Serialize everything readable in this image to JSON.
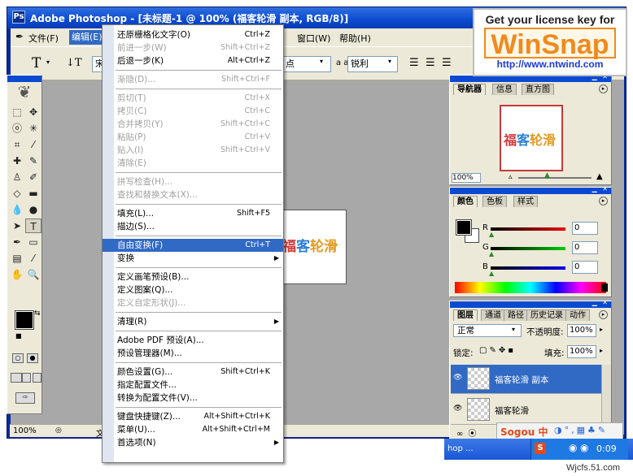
{
  "window": {
    "title": "Adobe Photoshop - [未标题-1 @ 100% (福客轮滑 副本, RGB/8)]"
  },
  "menubar": {
    "items": [
      "文件(F)",
      "编辑(E)",
      "窗口(W)",
      "帮助(H)"
    ]
  },
  "options": {
    "font_partial": "宋",
    "size_partial": "点",
    "aa_label": "a a",
    "antialias": "锐利"
  },
  "edit_menu": {
    "items": [
      {
        "label": "还原栅格化文字(O)",
        "shortcut": "Ctrl+Z",
        "state": "normal"
      },
      {
        "label": "前进一步(W)",
        "shortcut": "Shift+Ctrl+Z",
        "state": "disabled"
      },
      {
        "label": "后退一步(K)",
        "shortcut": "Alt+Ctrl+Z",
        "state": "normal"
      },
      {
        "sep": true
      },
      {
        "label": "渐隐(D)...",
        "shortcut": "Shift+Ctrl+F",
        "state": "disabled"
      },
      {
        "sep": true
      },
      {
        "label": "剪切(T)",
        "shortcut": "Ctrl+X",
        "state": "disabled"
      },
      {
        "label": "拷贝(C)",
        "shortcut": "Ctrl+C",
        "state": "disabled"
      },
      {
        "label": "合并拷贝(Y)",
        "shortcut": "Shift+Ctrl+C",
        "state": "disabled"
      },
      {
        "label": "粘贴(P)",
        "shortcut": "Ctrl+V",
        "state": "disabled"
      },
      {
        "label": "贴入(I)",
        "shortcut": "Shift+Ctrl+V",
        "state": "disabled"
      },
      {
        "label": "清除(E)",
        "shortcut": "",
        "state": "disabled"
      },
      {
        "sep": true
      },
      {
        "label": "拼写检查(H)...",
        "shortcut": "",
        "state": "disabled"
      },
      {
        "label": "查找和替换文本(X)...",
        "shortcut": "",
        "state": "disabled"
      },
      {
        "sep": true
      },
      {
        "label": "填充(L)...",
        "shortcut": "Shift+F5",
        "state": "normal"
      },
      {
        "label": "描边(S)...",
        "shortcut": "",
        "state": "normal"
      },
      {
        "sep": true
      },
      {
        "label": "自由变换(F)",
        "shortcut": "Ctrl+T",
        "state": "highlight"
      },
      {
        "label": "变换",
        "shortcut": "",
        "state": "normal",
        "submenu": true
      },
      {
        "sep": true
      },
      {
        "label": "定义画笔预设(B)...",
        "shortcut": "",
        "state": "normal"
      },
      {
        "label": "定义图案(Q)...",
        "shortcut": "",
        "state": "normal"
      },
      {
        "label": "定义自定形状(J)...",
        "shortcut": "",
        "state": "disabled"
      },
      {
        "sep": true
      },
      {
        "label": "清理(R)",
        "shortcut": "",
        "state": "normal",
        "submenu": true
      },
      {
        "sep": true
      },
      {
        "label": "Adobe PDF 预设(A)...",
        "shortcut": "",
        "state": "normal"
      },
      {
        "label": "预设管理器(M)...",
        "shortcut": "",
        "state": "normal"
      },
      {
        "sep": true
      },
      {
        "label": "颜色设置(G)...",
        "shortcut": "Shift+Ctrl+K",
        "state": "normal"
      },
      {
        "label": "指定配置文件...",
        "shortcut": "",
        "state": "normal"
      },
      {
        "label": "转换为配置文件(V)...",
        "shortcut": "",
        "state": "normal"
      },
      {
        "sep": true
      },
      {
        "label": "键盘快捷键(Z)...",
        "shortcut": "Alt+Shift+Ctrl+K",
        "state": "normal"
      },
      {
        "label": "菜单(U)...",
        "shortcut": "Alt+Shift+Ctrl+M",
        "state": "normal"
      },
      {
        "label": "首选项(N)",
        "shortcut": "",
        "state": "normal",
        "submenu": true
      }
    ]
  },
  "document": {
    "text_parts": [
      "福",
      "客",
      "轮",
      "滑"
    ],
    "visible_text": "客轮滑",
    "zoom": "100%",
    "status_partial": "文"
  },
  "navigator": {
    "tabs": [
      "导航器",
      "信息",
      "直方图"
    ],
    "zoom": "100%",
    "preview_text_parts": [
      "福",
      "客",
      "轮",
      "滑"
    ]
  },
  "color_panel": {
    "tabs": [
      "颜色",
      "色板",
      "样式"
    ],
    "channels": [
      {
        "label": "R",
        "value": "0",
        "color": "#c02020"
      },
      {
        "label": "G",
        "value": "0",
        "color": "#20a020"
      },
      {
        "label": "B",
        "value": "0",
        "color": "#2020c0"
      }
    ]
  },
  "layers_panel": {
    "tabs": [
      "图层",
      "通道",
      "路径",
      "历史记录",
      "动作"
    ],
    "blend_mode": "正常",
    "opacity_label": "不透明度:",
    "opacity": "100%",
    "lock_label": "锁定:",
    "fill_label": "填充:",
    "fill": "100%",
    "layers": [
      {
        "name": "福客轮滑 副本",
        "selected": true
      },
      {
        "name": "福客轮滑",
        "selected": false
      }
    ]
  },
  "ad": {
    "line1": "Get your license key for",
    "logo": "WinSnap",
    "url": "http://www.ntwind.com"
  },
  "taskbar": {
    "item_partial": "hop ...",
    "ime_label": "Sogou 中",
    "time": "0:09"
  },
  "watermark": "Wjcfs.51.com",
  "colors": {
    "title_blue": "#0b4ad0",
    "highlight": "#316ac5",
    "text_red": "#d23a3a",
    "text_blue": "#2a7ed6",
    "text_orange": "#e59a23",
    "ad_orange": "#f08a1c"
  }
}
